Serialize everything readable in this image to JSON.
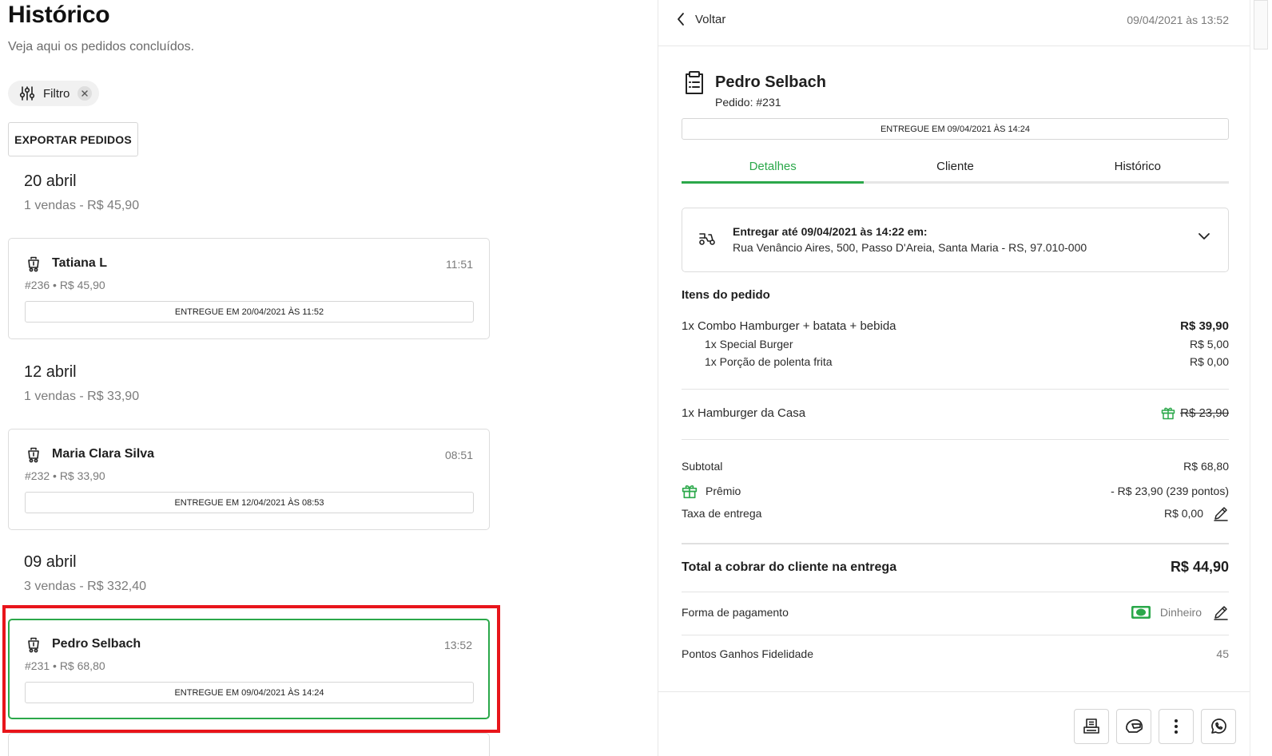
{
  "history": {
    "title": "Histórico",
    "subtitle": "Veja aqui os pedidos concluídos.",
    "filter_label": "Filtro",
    "export_label": "EXPORTAR PEDIDOS",
    "groups": [
      {
        "date": "20 abril",
        "summary": "1 vendas - R$ 45,90",
        "orders": [
          {
            "name": "Tatiana L",
            "time": "11:51",
            "meta": "#236 • R$ 45,90",
            "status": "ENTREGUE EM 20/04/2021 ÀS 11:52"
          }
        ]
      },
      {
        "date": "12 abril",
        "summary": "1 vendas - R$ 33,90",
        "orders": [
          {
            "name": "Maria Clara Silva",
            "time": "08:51",
            "meta": "#232 • R$ 33,90",
            "status": "ENTREGUE EM 12/04/2021 ÀS 08:53"
          }
        ]
      },
      {
        "date": "09 abril",
        "summary": "3 vendas - R$ 332,40",
        "orders": [
          {
            "name": "Pedro Selbach",
            "time": "13:52",
            "meta": "#231 • R$ 68,80",
            "status": "ENTREGUE EM 09/04/2021 ÀS 14:24"
          }
        ]
      }
    ]
  },
  "detail": {
    "back_label": "Voltar",
    "datetime": "09/04/2021 às 13:52",
    "customer_name": "Pedro Selbach",
    "order_number": "Pedido: #231",
    "status": "ENTREGUE EM 09/04/2021 ÀS 14:24",
    "tabs": [
      {
        "label": "Detalhes",
        "active": true
      },
      {
        "label": "Cliente",
        "active": false
      },
      {
        "label": "Histórico",
        "active": false
      }
    ],
    "delivery": {
      "title": "Entregar até 09/04/2021 às 14:22 em:",
      "address": "Rua Venâncio Aires, 500, Passo D'Areia, Santa Maria - RS, 97.010-000"
    },
    "items_title": "Itens do pedido",
    "items": [
      {
        "label": "1x Combo Hamburger + batata + bebida",
        "price": "R$ 39,90"
      },
      {
        "label": "1x Special Burger",
        "price": "R$ 5,00"
      },
      {
        "label": "1x Porção de polenta frita",
        "price": "R$ 0,00"
      },
      {
        "label": "1x Hamburger da Casa",
        "price": "R$ 23,90"
      }
    ],
    "subtotal_label": "Subtotal",
    "subtotal_value": "R$ 68,80",
    "reward_label": "Prêmio",
    "reward_value": "- R$ 23,90 (239 pontos)",
    "fee_label": "Taxa de entrega",
    "fee_value": "R$ 0,00",
    "total_label": "Total a cobrar do cliente na entrega",
    "total_value": "R$ 44,90",
    "payment_label": "Forma de pagamento",
    "payment_value": "Dinheiro",
    "points_label": "Pontos Ganhos Fidelidade",
    "points_value": "45"
  },
  "colors": {
    "accent_green": "#2ba84a",
    "highlight_red": "#e8151b",
    "muted_text": "#7a7a7a"
  },
  "icons": [
    "filter-sliders-icon",
    "close-icon",
    "delivery-bag-icon",
    "clipboard-icon",
    "chevron-left-icon",
    "motorcycle-icon",
    "chevron-down-icon",
    "gift-icon",
    "pencil-icon",
    "cash-icon",
    "printer-icon",
    "helmet-icon",
    "more-vertical-icon",
    "whatsapp-icon"
  ]
}
